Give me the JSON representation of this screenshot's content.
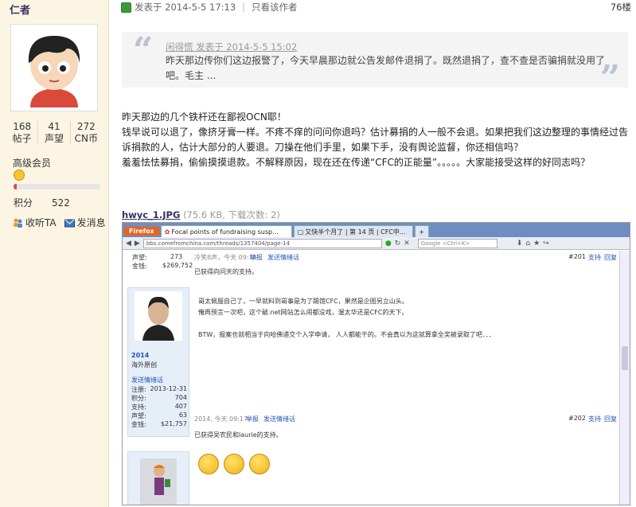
{
  "user": {
    "name": "仁者",
    "stats": [
      {
        "value": "168",
        "label": "帖子"
      },
      {
        "value": "41",
        "label": "声望"
      },
      {
        "value": "272",
        "label": "CN币"
      }
    ],
    "level": "高级会员",
    "progress": 0.04,
    "points_label": "积分",
    "points_value": "522",
    "listen_label": "收听TA",
    "message_label": "发消息"
  },
  "post": {
    "posted_label": "发表于 2014-5-5 17:13",
    "author_only": "只看该作者",
    "floor": "76楼",
    "quote": {
      "author": "闲得慌 发表于 2014-5-5 15:02",
      "text": "昨天那边传你们这边报警了，今天早晨那边就公告发邮件退捐了。既然退捐了，查不查是否骗捐就没用了吧。毛主 ..."
    },
    "body": [
      "昨天那边的几个铁杆还在鄙视OCN耶！",
      "钱早说可以退了，像挤牙膏一样。不疼不痒的问问你退吗？估计募捐的人一般不会退。如果把我们这边整理的事情经过告诉捐款的人，估计大部分的人要退。刀操在他们手里，如果下手，没有舆论监督，你还相信吗？",
      "羞羞怯怯募捐，偷偷摸摸退款。不解释原因，现在还在传递“CFC的正能量”。。。。。大家能接受这样的好同志吗？"
    ],
    "attachment": {
      "filename": "hwyc_1.JPG",
      "meta": "(75.6 KB, 下载次数: 2)"
    }
  },
  "screenshot": {
    "browser_logo": "Firefox",
    "tabs": [
      "Focal points of fundraising susp...",
      "又快半个月了 | 第 14 页 | CFC中...",
      "+"
    ],
    "url": "bbs.comefromchina.com/threads/1357404/page-14",
    "search_placeholder": "Google <Ctrl+K>",
    "r1_rep_label": "声望:",
    "r1_rep": "273",
    "r1_money_label": "金钱:",
    "r1_money": "$269,752",
    "r1_date": "冷笑8声，今天 09:15",
    "r1_report": "举报",
    "r1_send": "发送情绪话",
    "r1_floor": "#201",
    "r1_support": "支持",
    "r1_reply": "回复",
    "r1_got": "已获得向问天的支持。",
    "post_line1": "哥太佩服自己了，一早就料到哥事是为了踢馆CFC，果然是企图另立山头。",
    "post_line2": "俺再预言一次吧，这个破.net网站怎么闹都没戏，渥太华还是CFC的天下。",
    "post_line3": "BTW，报案也就相当于向哈佛递交个入学申请， 人人都能干的。不会真以为这就算拿全奖被录取了吧．．．",
    "user_name": "2014",
    "user_title": "海外原创",
    "user_send": "发送情绪话",
    "reg_label": "注册:",
    "reg": "2013-12-31",
    "pts_label": "积分:",
    "pts": "704",
    "sup_label": "支持:",
    "sup": "407",
    "rep_label": "声望:",
    "rep": "63",
    "money_label": "金钱:",
    "money": "$21,757",
    "r2_date": "2014, 今天 09:17",
    "r2_report": "举报",
    "r2_send": "发送情绪话",
    "r2_floor": "#202",
    "r2_support": "支持",
    "r2_reply": "回复",
    "r2_got": "已获得吴农民和laurie的支持。"
  }
}
